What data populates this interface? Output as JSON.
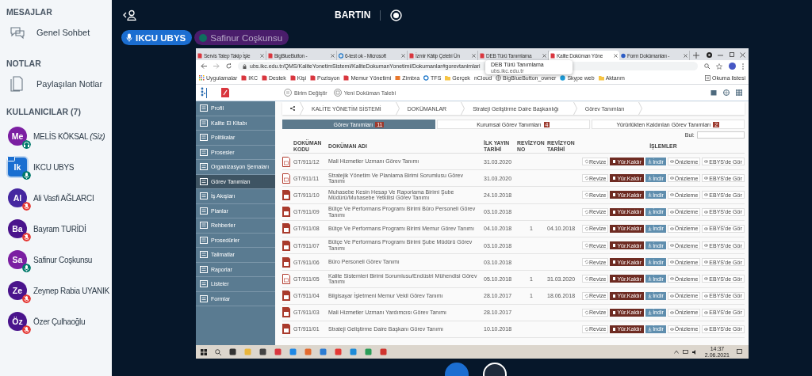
{
  "sidebar": {
    "messages": {
      "heading": "MESAJLAR",
      "items": [
        {
          "label": "Genel Sohbet"
        }
      ]
    },
    "notes": {
      "heading": "NOTLAR",
      "items": [
        {
          "label": "Paylaşılan Notlar"
        }
      ]
    },
    "users": {
      "heading": "KULLANICILAR (7)",
      "items": [
        {
          "initials": "Me",
          "name": "MELİS KÖKSAL",
          "suffix": "(Siz)",
          "color": "#7b1fa2",
          "kind": "listen",
          "presenter": false
        },
        {
          "initials": "Ik",
          "name": "IKCU UBYS",
          "color": "#1a6fd1",
          "kind": "mic",
          "presenter": true
        },
        {
          "initials": "Al",
          "name": "Ali Vasfi AĞLARCI",
          "color": "#4527a0",
          "kind": "muted",
          "presenter": false
        },
        {
          "initials": "Ba",
          "name": "Bayram TURİDİ",
          "color": "#4a148c",
          "kind": "muted",
          "presenter": false
        },
        {
          "initials": "Sa",
          "name": "Safinur Coşkunsu",
          "color": "#7b1fa2",
          "kind": "mic",
          "presenter": false
        },
        {
          "initials": "Ze",
          "name": "Zeynep Rabia UYANIK",
          "color": "#4a148c",
          "kind": "muted",
          "presenter": false
        },
        {
          "initials": "Öz",
          "name": "Özer Çulhaoğlu",
          "color": "#4a148c",
          "kind": "muted",
          "presenter": false
        }
      ]
    }
  },
  "topbar": {
    "title": "BARTIN"
  },
  "talkers": [
    {
      "name": "IKCU UBYS",
      "talking": true
    },
    {
      "name": "Safinur Coşkunsu",
      "talking": false
    }
  ],
  "browser": {
    "tabs": [
      {
        "title": "Servis Talep Takip İşle",
        "selected": false
      },
      {
        "title": "BigBlueButton - ",
        "selected": false
      },
      {
        "title": "6-test ok - Microsoft ",
        "selected": false
      },
      {
        "title": "İzmir Kâtip Çelebi Ün",
        "selected": false
      },
      {
        "title": "DEB Türü Tanımlama",
        "selected": false
      },
      {
        "title": "Kalite Doküman Yöne",
        "selected": true
      },
      {
        "title": "Form Dokümanları - ",
        "selected": false
      }
    ],
    "url": "ubs.ikc.edu.tr/QMS/KaliteYonetimSistemi/KaliteDokumanYonetimi/Dokumanlar#gorevtanimlari",
    "tooltip": {
      "title": "DEB Türü Tanımlama",
      "url": "ubs.ikc.edu.tr"
    },
    "bookmarks": [
      {
        "label": "Uygulamalar",
        "kind": "grid"
      },
      {
        "label": "IKC",
        "kind": "site"
      },
      {
        "label": "Destek",
        "kind": "site"
      },
      {
        "label": "Kişi",
        "kind": "site"
      },
      {
        "label": "Pozisyon",
        "kind": "site"
      },
      {
        "label": "Memur Yönetimi",
        "kind": "site"
      },
      {
        "label": "Zimbra",
        "kind": "mail"
      },
      {
        "label": "TFS",
        "kind": "cloud"
      },
      {
        "label": "Gerçek",
        "kind": "folder"
      },
      {
        "label": "nCloud",
        "kind": "bare"
      },
      {
        "label": "BigBlueButton_owner",
        "kind": "globe"
      },
      {
        "label": "Skype web",
        "kind": "skype"
      },
      {
        "label": "Aktarım",
        "kind": "folder"
      }
    ],
    "reading_list": "Okuma listesi"
  },
  "app": {
    "header_links": [
      "Birim Değiştir",
      "Yeni Doküman Talebi"
    ],
    "menu": [
      {
        "label": "Profil",
        "selected": false
      },
      {
        "label": "Kalite El Kitabı",
        "selected": false
      },
      {
        "label": "Politikalar",
        "selected": false
      },
      {
        "label": "Prosesler",
        "selected": false
      },
      {
        "label": "Organizasyon Şemaları",
        "selected": false
      },
      {
        "label": "Görev Tanımları",
        "selected": true
      },
      {
        "label": "İş Akışları",
        "selected": false
      },
      {
        "label": "Planlar",
        "selected": false
      },
      {
        "label": "Rehberler",
        "selected": false
      },
      {
        "label": "Prosedürler",
        "selected": false
      },
      {
        "label": "Talimatlar",
        "selected": false
      },
      {
        "label": "Raporlar",
        "selected": false
      },
      {
        "label": "Listeler",
        "selected": false
      },
      {
        "label": "Formlar",
        "selected": false
      }
    ],
    "breadcrumb": [
      "KALİTE YÖNETİM SİSTEMİ",
      "DOKÜMANLAR",
      "Strateji Geliştirme Daire Başkanlığı",
      "Görev Tanımları"
    ],
    "doc_tabs": [
      {
        "label": "Görev Tanımları",
        "count": "11",
        "selected": true
      },
      {
        "label": "Kurumsal Görev Tanımları",
        "count": "4",
        "selected": false
      },
      {
        "label": "Yürürlükten Kaldırılan Görev Tanımları",
        "count": "2",
        "selected": false
      }
    ],
    "search_label": "Bul:",
    "columns": [
      "DOKÜMAN KODU",
      "DOKÜMAN ADI",
      "İLK YAYIN TARİHİ",
      "REVİZYON NO",
      "REVİZYON TARİHİ",
      "İŞLEMLER"
    ],
    "rows": [
      {
        "kind": "outline",
        "code": "GT/911/12",
        "name": "Mali Hizmetler Uzmanı Görev Tanımı",
        "date": "31.03.2020",
        "actions": [
          "Revize",
          "Yür.Kaldır",
          "İndir",
          "Önizleme",
          "EBYS'de Gör"
        ]
      },
      {
        "kind": "outline",
        "code": "GT/911/11",
        "name": "Stratejik Yönetim Ve Planlama Birimi Sorumlusu Görev Tanımı",
        "date": "31.03.2020",
        "actions": [
          "Revize",
          "Yür.Kaldır",
          "İndir",
          "Önizleme",
          "EBYS'de Gör"
        ]
      },
      {
        "kind": "filled",
        "code": "GT/911/10",
        "name": "Muhasebe Kesin Hesap Ve Raporlama Birimi Şube Müdürü/Muhasebe Yetkilisi Görev Tanımı",
        "date": "24.10.2018",
        "actions": [
          "Revize",
          "Yür.Kaldır",
          "İndir",
          "Önizleme",
          "EBYS'de Gör"
        ]
      },
      {
        "kind": "filled",
        "code": "GT/911/09",
        "name": "Bütçe Ve Performans Programı Birimi Büro Personeli Görev Tanımı",
        "date": "03.10.2018",
        "actions": [
          "Revize",
          "Yür.Kaldır",
          "İndir",
          "Önizleme",
          "EBYS'de Gör"
        ]
      },
      {
        "kind": "filled",
        "code": "GT/911/08",
        "name": "Bütçe Ve Performans Programı Birimi Memur Görev Tanımı",
        "date": "04.10.2018",
        "rev_no": "1",
        "rev_date": "04.10.2018",
        "actions": [
          "Revize",
          "Yür.Kaldır",
          "İndir",
          "Önizleme",
          "EBYS'de Gör"
        ]
      },
      {
        "kind": "filled",
        "code": "GT/911/07",
        "name": "Bütçe Ve Performans Programı Birimi Şube Müdürü Görev Tanımı",
        "date": "03.10.2018",
        "actions": [
          "Revize",
          "Yür.Kaldır",
          "İndir",
          "Önizleme",
          "EBYS'de Gör"
        ]
      },
      {
        "kind": "filled",
        "code": "GT/911/06",
        "name": "Büro Personeli Görev Tanımı",
        "date": "03.10.2018",
        "actions": [
          "Revize",
          "Yür.Kaldır",
          "İndir",
          "Önizleme",
          "EBYS'de Gör"
        ]
      },
      {
        "kind": "outline",
        "code": "GT/911/05",
        "name": "Kalite Sistemleri Birimi Sorumlusu/Endüstri Mühendisi Görev Tanımı",
        "date": "05.10.2018",
        "rev_no": "1",
        "rev_date": "31.03.2020",
        "actions": [
          "Revize",
          "Yür.Kaldır",
          "İndir",
          "Önizleme",
          "EBYS'de Gör"
        ]
      },
      {
        "kind": "filled",
        "code": "GT/911/04",
        "name": "Bilgisayar İşletmeni Memur Vekil Görev Tanımı",
        "date": "28.10.2017",
        "rev_no": "1",
        "rev_date": "18.06.2018",
        "actions": [
          "Revize",
          "Yür.Kaldır",
          "İndir",
          "Önizleme",
          "EBYS'de Gör"
        ]
      },
      {
        "kind": "filled",
        "code": "GT/911/03",
        "name": "Mali Hizmetler Uzmanı Yardımcısı Görev Tanımı",
        "date": "28.10.2017",
        "actions": [
          "Revize",
          "Yür.Kaldır",
          "İndir",
          "Önizleme",
          "EBYS'de Gör"
        ]
      },
      {
        "kind": "filled",
        "code": "GT/911/01",
        "name": "Strateji Geliştirme Daire Başkanı Görev Tanımı",
        "date": "10.10.2018",
        "actions": [
          "Revize",
          "Yür.Kaldır",
          "İndir",
          "Önizleme",
          "EBYS'de Gör"
        ]
      }
    ]
  },
  "taskbar": {
    "time": "14:37",
    "date": "2.06.2021"
  }
}
